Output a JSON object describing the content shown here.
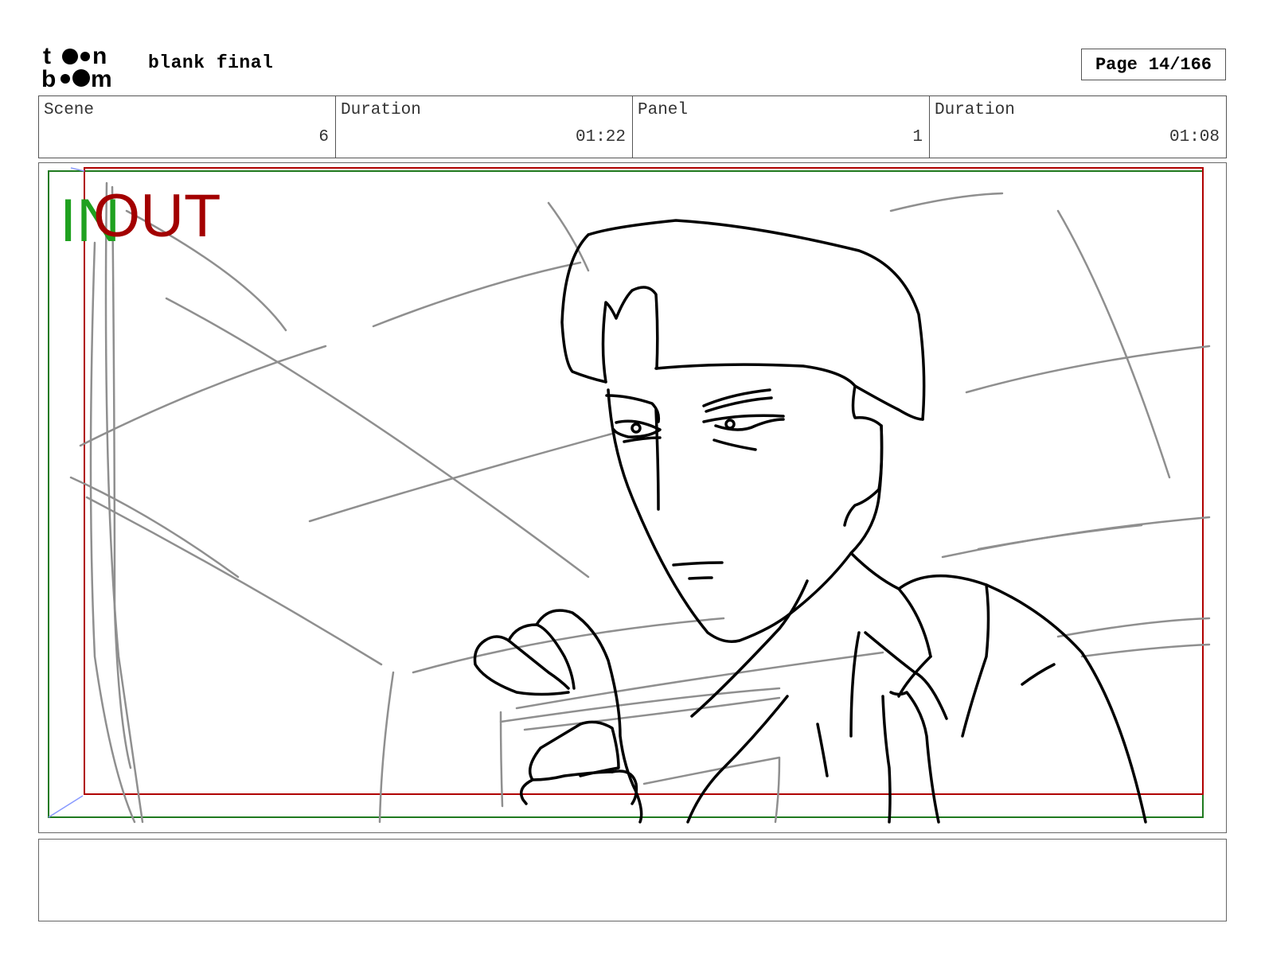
{
  "header": {
    "logo_text": "toon boom",
    "document_title": "blank final",
    "page_label": "Page",
    "page_number": "14/166"
  },
  "info": [
    {
      "label": "Scene",
      "value": "6"
    },
    {
      "label": "Duration",
      "value": "01:22"
    },
    {
      "label": "Panel",
      "value": "1"
    },
    {
      "label": "Duration",
      "value": "01:08"
    }
  ],
  "panel": {
    "in_label": "IN",
    "out_label": "OUT",
    "in_frame_color": "#1f7a1f",
    "out_frame_color": "#b00000",
    "sketch_description_icon": "character-sketch"
  },
  "dialog": {
    "text": ""
  }
}
